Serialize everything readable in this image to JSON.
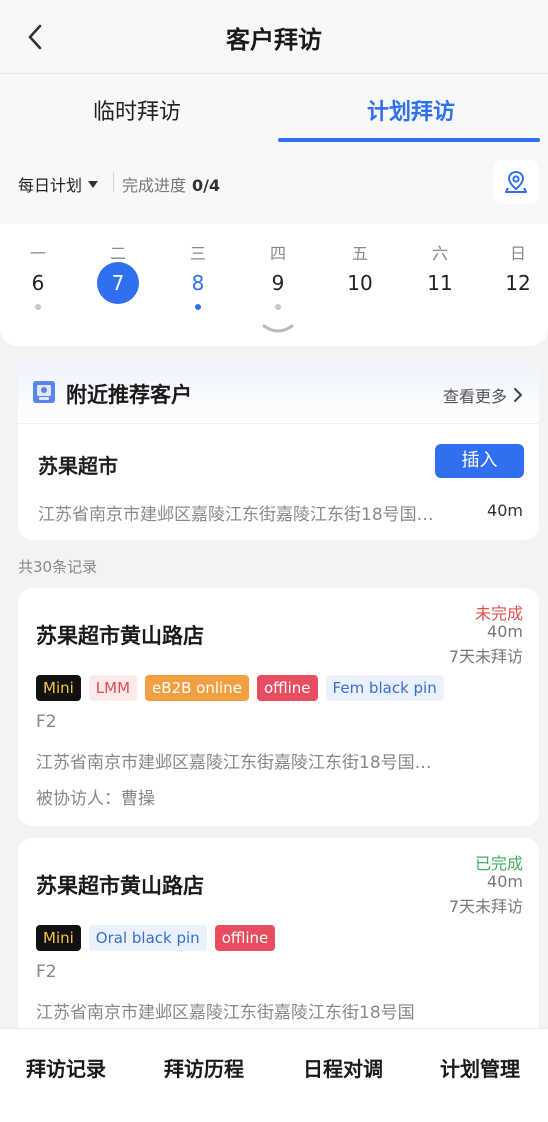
{
  "header": {
    "title": "客户拜访"
  },
  "tabs": [
    {
      "label": "临时拜访"
    },
    {
      "label": "计划拜访"
    }
  ],
  "filter": {
    "plan_label": "每日计划",
    "progress_label": "完成进度",
    "progress_value": "0/4"
  },
  "calendar": {
    "days": [
      {
        "weekday": "一",
        "date": "6"
      },
      {
        "weekday": "二",
        "date": "7"
      },
      {
        "weekday": "三",
        "date": "8"
      },
      {
        "weekday": "四",
        "date": "9"
      },
      {
        "weekday": "五",
        "date": "10"
      },
      {
        "weekday": "六",
        "date": "11"
      },
      {
        "weekday": "日",
        "date": "12"
      }
    ]
  },
  "nearby": {
    "title": "附近推荐客户",
    "more_label": "查看更多",
    "customer_name": "苏果超市",
    "insert_label": "插入",
    "address": "江苏省南京市建邺区嘉陵江东街嘉陵江东街18号国…",
    "distance": "40m"
  },
  "records": {
    "count_label": "共30条记录"
  },
  "cards": [
    {
      "name": "苏果超市黄山路店",
      "status": "未完成",
      "distance": "40m",
      "last_visit": "7天未拜访",
      "tags": [
        "Mini",
        "LMM",
        "eB2B online",
        "offline",
        "Fem black pin"
      ],
      "floor": "F2",
      "address": "江苏省南京市建邺区嘉陵江东街嘉陵江东街18号国…",
      "assist_label": "被协访人：",
      "assist_name": "曹操"
    },
    {
      "name": "苏果超市黄山路店",
      "status": "已完成",
      "distance": "40m",
      "last_visit": "7天未拜访",
      "tags": [
        "Mini",
        "Oral black pin",
        "offline"
      ],
      "floor": "F2",
      "address": "江苏省南京市建邺区嘉陵江东街嘉陵江东街18号国"
    }
  ],
  "bottom_nav": [
    "拜访记录",
    "拜访历程",
    "日程对调",
    "计划管理"
  ],
  "colors": {
    "primary": "#2f6ff0",
    "incomplete": "#e0504a",
    "complete": "#3fae5a"
  }
}
